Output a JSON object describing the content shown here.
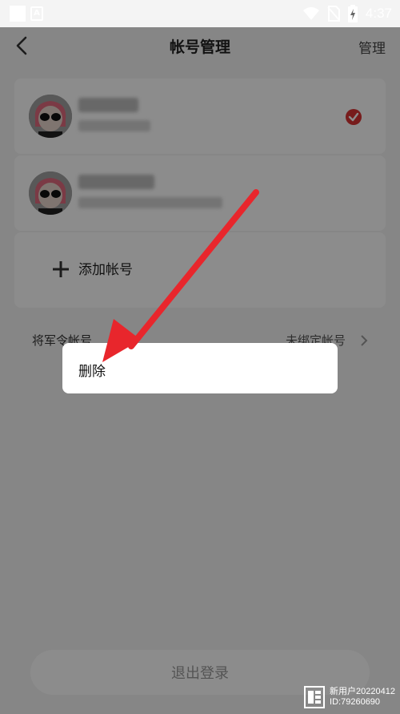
{
  "statusbar": {
    "time": "4:37",
    "a_badge": "A"
  },
  "header": {
    "title": "帐号管理",
    "manage_label": "管理"
  },
  "accounts": [
    {
      "selected": true
    },
    {
      "selected": false
    }
  ],
  "add_account_label": "添加帐号",
  "binding": {
    "left_label": "将军令帐号",
    "right_label": "未绑定帐号"
  },
  "popup": {
    "delete_label": "删除"
  },
  "logout_label": "退出登录",
  "watermark": {
    "line1": "新用户20220412",
    "line2": "ID:79260690"
  },
  "colors": {
    "accent_red": "#d93333",
    "arrow_red": "#e8262c"
  }
}
